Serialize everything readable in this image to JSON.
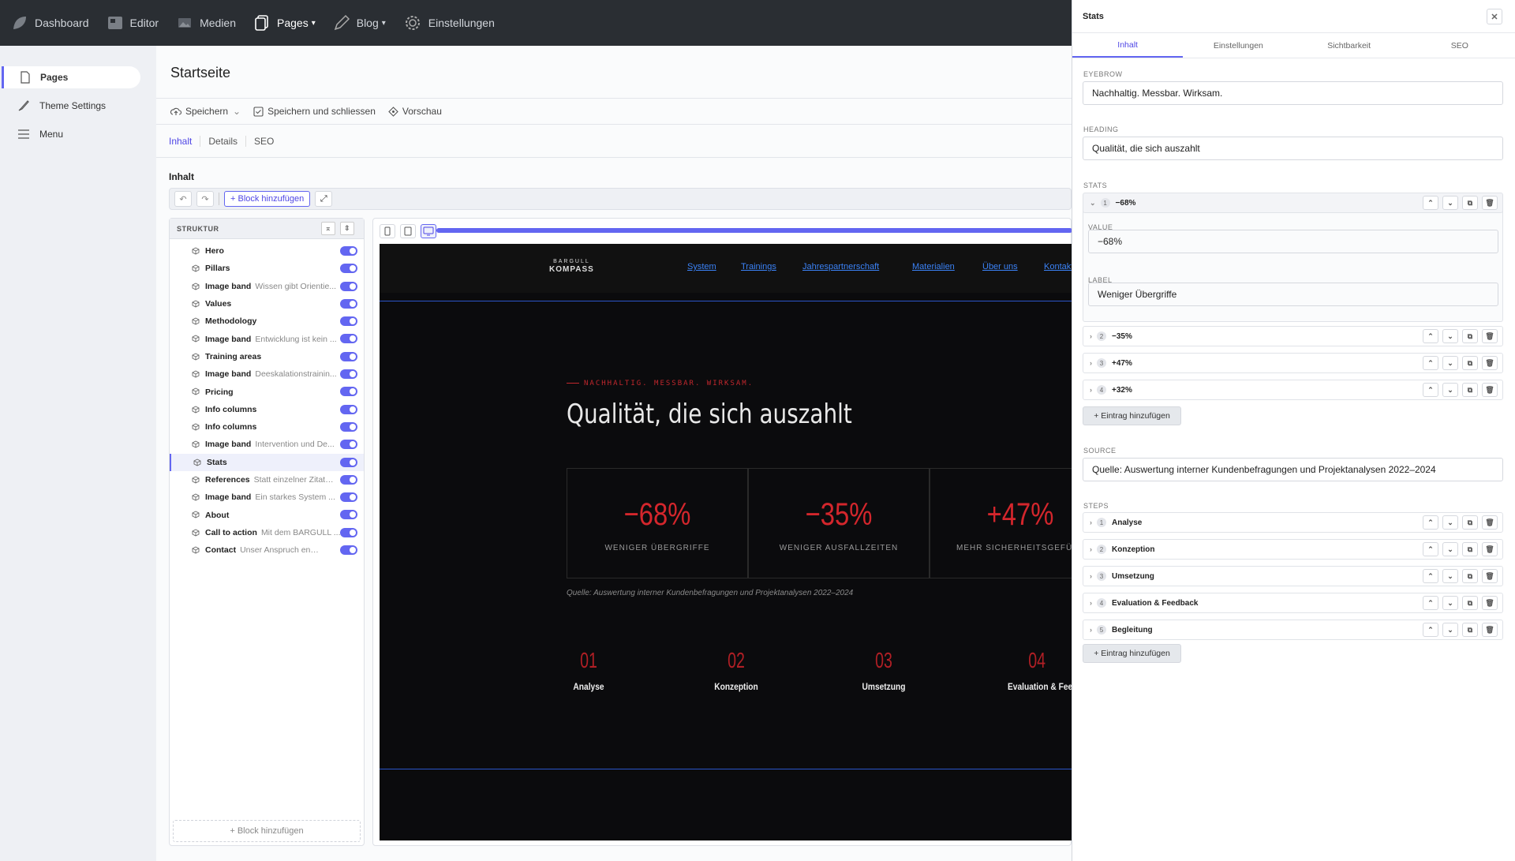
{
  "topnav": {
    "items": [
      {
        "label": "Dashboard"
      },
      {
        "label": "Editor"
      },
      {
        "label": "Medien"
      },
      {
        "label": "Pages"
      },
      {
        "label": "Blog"
      },
      {
        "label": "Einstellungen"
      }
    ]
  },
  "sidebar": {
    "items": [
      {
        "label": "Pages"
      },
      {
        "label": "Theme Settings"
      },
      {
        "label": "Menu"
      }
    ]
  },
  "main": {
    "title": "Startseite",
    "toolbar": {
      "save": "Speichern",
      "save_close": "Speichern und schliessen",
      "preview": "Vorschau"
    },
    "tabs": [
      "Inhalt",
      "Details",
      "SEO"
    ],
    "content_label": "Inhalt",
    "add_block": "+ Block hinzufügen",
    "structure_title": "STRUKTUR",
    "structure_items": [
      {
        "name": "Hero",
        "sub": ""
      },
      {
        "name": "Pillars",
        "sub": ""
      },
      {
        "name": "Image band",
        "sub": "Wissen gibt Orientie..."
      },
      {
        "name": "Values",
        "sub": ""
      },
      {
        "name": "Methodology",
        "sub": ""
      },
      {
        "name": "Image band",
        "sub": "Entwicklung ist kein ..."
      },
      {
        "name": "Training areas",
        "sub": ""
      },
      {
        "name": "Image band",
        "sub": "Deeskalationstrainin..."
      },
      {
        "name": "Pricing",
        "sub": ""
      },
      {
        "name": "Info columns",
        "sub": ""
      },
      {
        "name": "Info columns",
        "sub": ""
      },
      {
        "name": "Image band",
        "sub": "Intervention und De..."
      },
      {
        "name": "Stats",
        "sub": ""
      },
      {
        "name": "References",
        "sub": "Statt einzelner Zitate..."
      },
      {
        "name": "Image band",
        "sub": "Ein starkes System ..."
      },
      {
        "name": "About",
        "sub": ""
      },
      {
        "name": "Call to action",
        "sub": "Mit dem BARGULL ..."
      },
      {
        "name": "Contact",
        "sub": "Unser Anspruch endet n..."
      }
    ],
    "structure_add": "+ Block hinzufügen"
  },
  "preview": {
    "logo_top": "BARGULL",
    "logo_bottom": "KOMPASS",
    "nav_links": [
      "System",
      "Trainings",
      "Jahrespartnerschaft",
      "Materialien",
      "Über uns",
      "Kontakt"
    ],
    "eyebrow": "NACHHALTIG. MESSBAR. WIRKSAM.",
    "heading": "Qualität, die sich auszahlt",
    "stats": [
      {
        "value": "−68%",
        "label": "WENIGER ÜBERGRIFFE"
      },
      {
        "value": "−35%",
        "label": "WENIGER AUSFALLZEITEN"
      },
      {
        "value": "+47%",
        "label": "MEHR SICHERHEITSGEFÜHL"
      }
    ],
    "source": "Quelle: Auswertung interner Kundenbefragungen und Projektanalysen 2022–2024",
    "steps": [
      {
        "num": "01",
        "label": "Analyse"
      },
      {
        "num": "02",
        "label": "Konzeption"
      },
      {
        "num": "03",
        "label": "Umsetzung"
      },
      {
        "num": "04",
        "label": "Evaluation & Feedback"
      }
    ]
  },
  "panel": {
    "title": "Stats",
    "tabs": [
      "Inhalt",
      "Einstellungen",
      "Sichtbarkeit",
      "SEO"
    ],
    "eyebrow_label": "EYEBROW",
    "eyebrow_value": "Nachhaltig. Messbar. Wirksam.",
    "heading_label": "HEADING",
    "heading_value": "Qualität, die sich auszahlt",
    "stats_label": "STATS",
    "stats_items": [
      {
        "num": "1",
        "title": "−68%"
      },
      {
        "num": "2",
        "title": "−35%"
      },
      {
        "num": "3",
        "title": "+47%"
      },
      {
        "num": "4",
        "title": "+32%"
      }
    ],
    "value_label": "VALUE",
    "value_value": "−68%",
    "label_label": "LABEL",
    "label_value": "Weniger Übergriffe",
    "add_entry": "+ Eintrag hinzufügen",
    "source_label": "SOURCE",
    "source_value": "Quelle: Auswertung interner Kundenbefragungen und Projektanalysen 2022–2024",
    "steps_label": "STEPS",
    "steps_items": [
      {
        "num": "1",
        "title": "Analyse"
      },
      {
        "num": "2",
        "title": "Konzeption"
      },
      {
        "num": "3",
        "title": "Umsetzung"
      },
      {
        "num": "4",
        "title": "Evaluation & Feedback"
      },
      {
        "num": "5",
        "title": "Begleitung"
      }
    ]
  },
  "colors": {
    "accent": "#6366f1",
    "preview_red": "#d4262c",
    "topbar": "#2a2e33"
  }
}
